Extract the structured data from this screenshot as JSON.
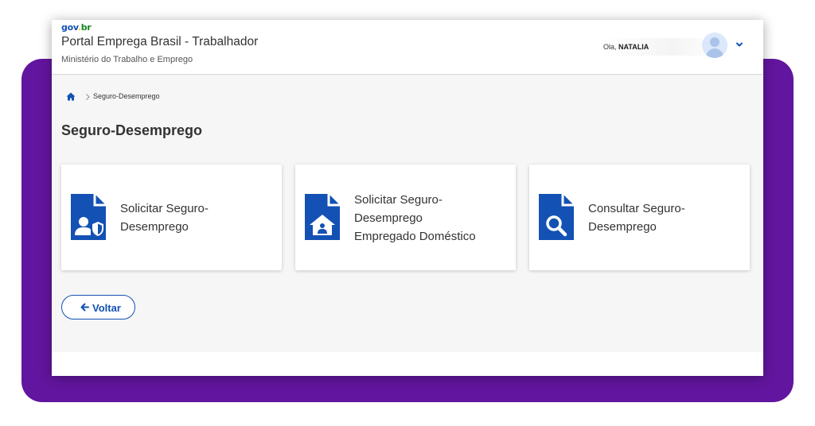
{
  "header": {
    "logo_gov": "gov",
    "logo_dot": ".",
    "logo_br": "br",
    "title": "Portal Emprega Brasil - Trabalhador",
    "subtitle": "Ministério do Trabalho e Emprego",
    "greeting": "Ola,",
    "user_name": "NATALIA"
  },
  "breadcrumb": {
    "items": [
      "Seguro-Desemprego"
    ]
  },
  "page": {
    "title": "Seguro-Desemprego"
  },
  "cards": [
    {
      "icon": "document-user-shield-icon",
      "lines": [
        "Solicitar Seguro-",
        "Desemprego"
      ]
    },
    {
      "icon": "document-house-icon",
      "lines": [
        "Solicitar Seguro-",
        "Desemprego",
        "Empregado Doméstico"
      ]
    },
    {
      "icon": "document-search-icon",
      "lines": [
        "Consultar Seguro-",
        "Desemprego"
      ]
    }
  ],
  "back_button": {
    "label": "Voltar"
  },
  "colors": {
    "frame": "#62159e",
    "primary": "#1351b4",
    "background": "#f6f6f6"
  }
}
